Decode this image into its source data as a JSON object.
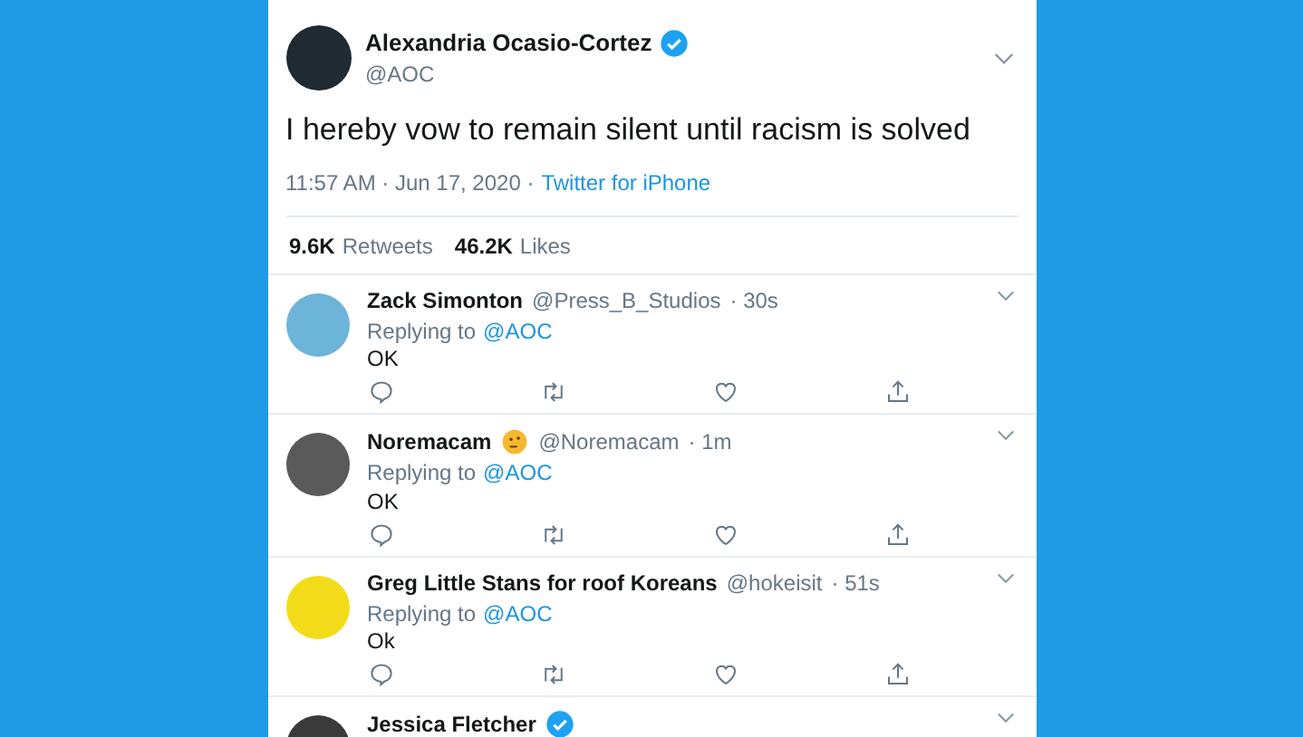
{
  "tweet": {
    "name": "Alexandria Ocasio-Cortez",
    "verified": true,
    "handle": "@AOC",
    "text": "I hereby vow to remain silent until racism is solved",
    "time": "11:57 AM · Jun 17, 2020 ·",
    "source": "Twitter for iPhone",
    "retweets": "9.6K",
    "retweets_label": "Retweets",
    "likes": "46.2K",
    "likes_label": "Likes"
  },
  "replies": [
    {
      "name": "Zack Simonton",
      "verified": false,
      "emoji": false,
      "handle": "@Press_B_Studios",
      "time": "· 30s",
      "replying_label": "Replying to",
      "replying_to": "@AOC",
      "text": "OK",
      "color": "#6cb4d8"
    },
    {
      "name": "Noremacam",
      "verified": false,
      "emoji": true,
      "handle": "@Noremacam",
      "time": "· 1m",
      "replying_label": "Replying to",
      "replying_to": "@AOC",
      "text": "OK",
      "color": "#5a5a5a"
    },
    {
      "name": "Greg Little Stans for roof Koreans",
      "verified": false,
      "emoji": false,
      "handle": "@hokeisit",
      "time": "· 51s",
      "replying_label": "Replying to",
      "replying_to": "@AOC",
      "text": "Ok",
      "color": "#f2dc1a"
    },
    {
      "name": "Jessica Fletcher",
      "verified": true,
      "emoji": false,
      "color": "#3a3a3a"
    }
  ]
}
